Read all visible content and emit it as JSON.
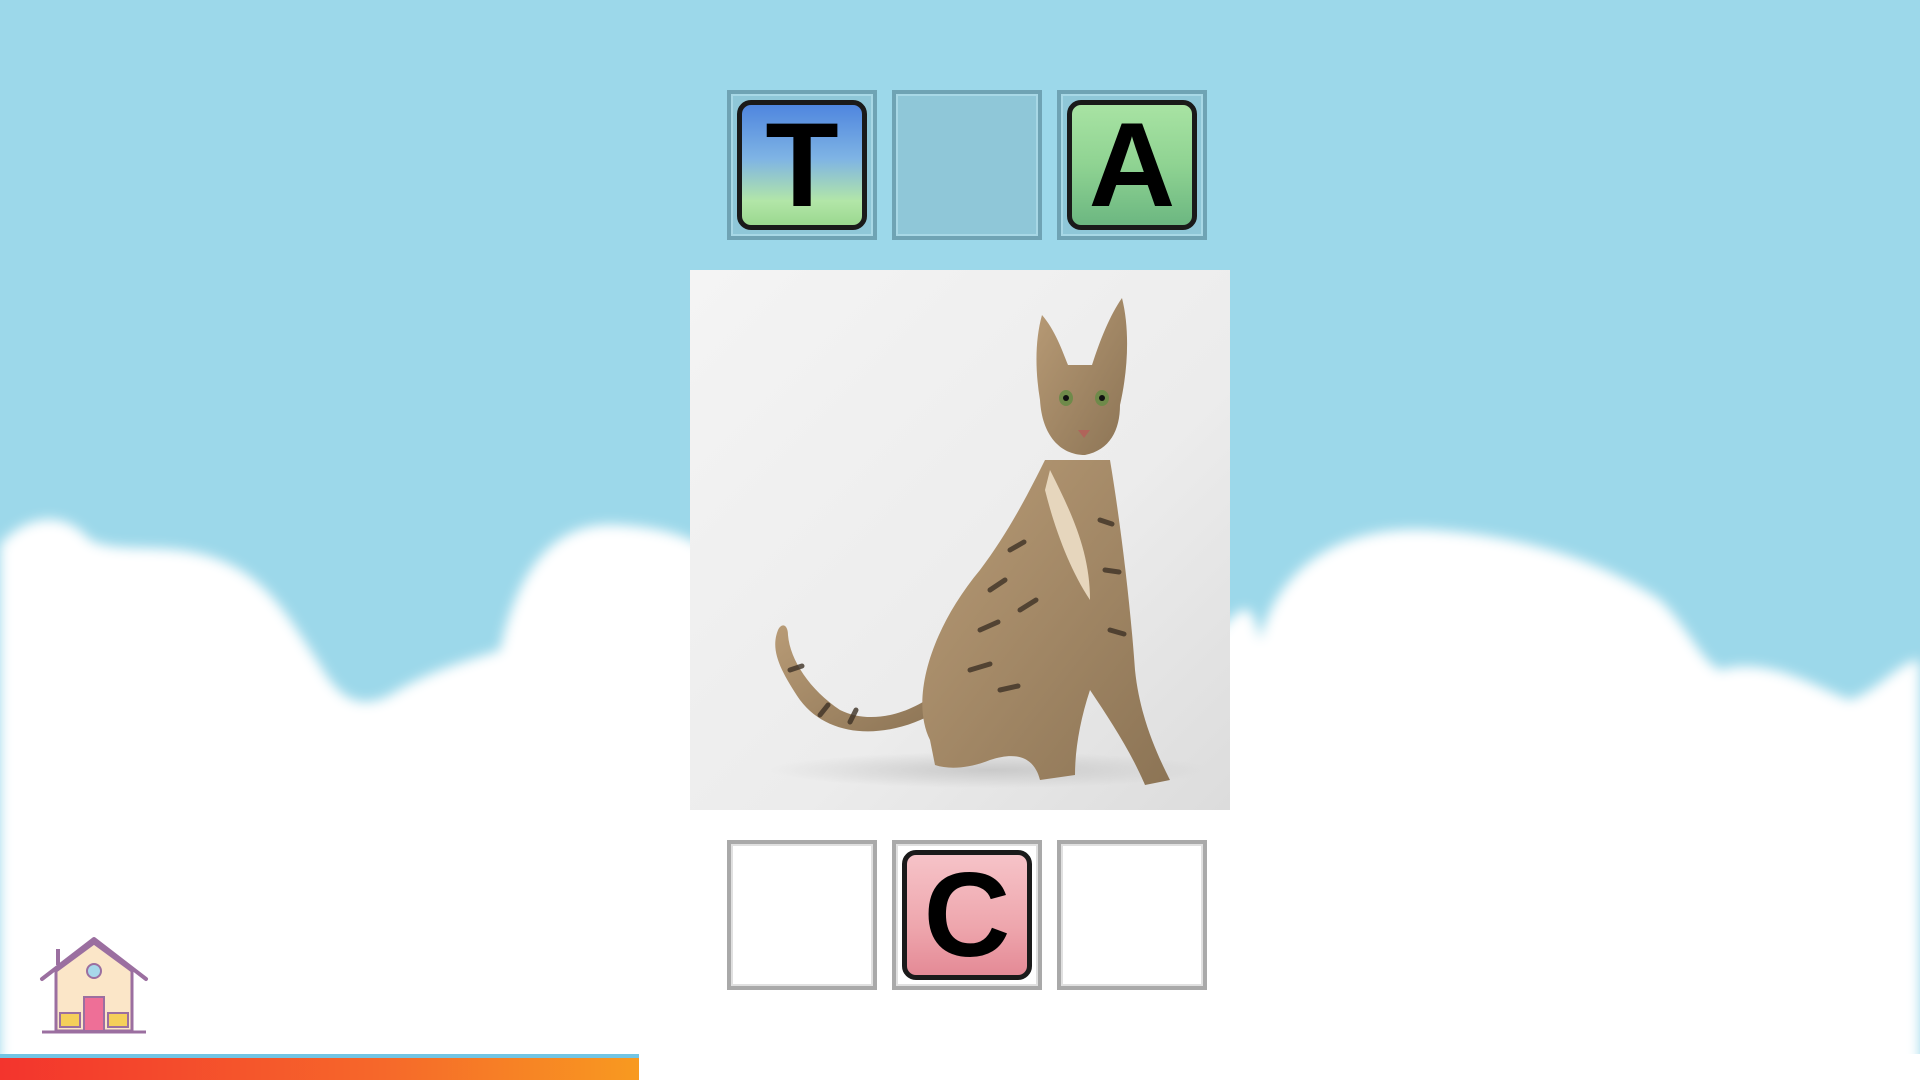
{
  "game": {
    "word_slots_top": [
      {
        "letter": "T",
        "style": "blue",
        "filled": true
      },
      {
        "letter": "",
        "style": "empty",
        "filled": false
      },
      {
        "letter": "A",
        "style": "green",
        "filled": true
      }
    ],
    "letter_bank_bottom": [
      {
        "letter": "",
        "filled": false
      },
      {
        "letter": "C",
        "style": "pink",
        "filled": true
      },
      {
        "letter": "",
        "filled": false
      }
    ],
    "picture": "cat-photo",
    "progress": 0.333
  },
  "icons": {
    "home": "house-icon"
  },
  "colors": {
    "sky": "#9cd8ea",
    "cloud": "#ffffff",
    "tile_blue": "#5f93df",
    "tile_green": "#8fd392",
    "tile_pink": "#eea6ad",
    "progress_start": "#f3342d",
    "progress_end": "#f89a20"
  }
}
